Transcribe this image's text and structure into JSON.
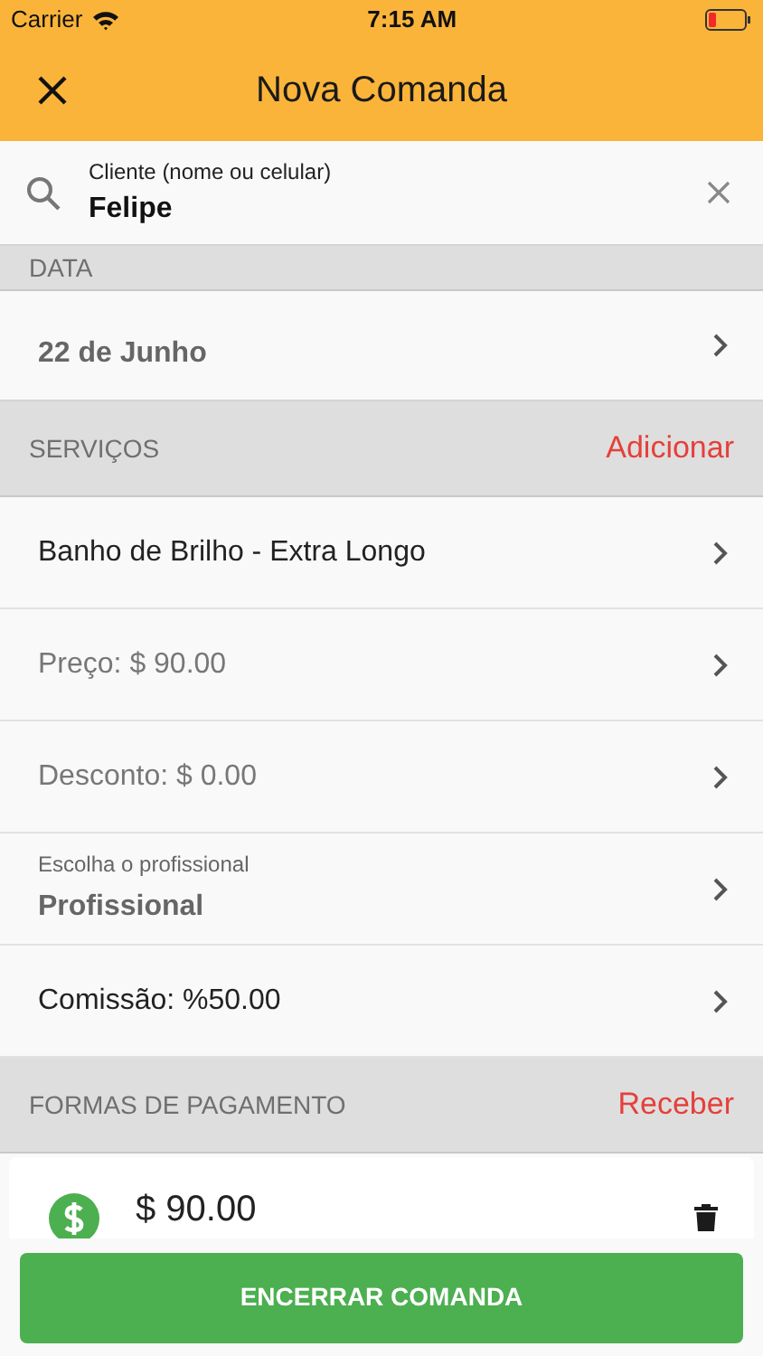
{
  "status_bar": {
    "carrier": "Carrier",
    "time": "7:15 AM"
  },
  "header": {
    "title": "Nova Comanda"
  },
  "client_field": {
    "label": "Cliente (nome ou celular)",
    "value": "Felipe"
  },
  "date_section": {
    "heading": "DATA",
    "value": "22 de Junho"
  },
  "services": {
    "heading": "SERVIÇOS",
    "action": "Adicionar",
    "rows": [
      {
        "kind": "title",
        "text": "Banho de Brilho - Extra Longo"
      },
      {
        "kind": "muted",
        "text": "Preço: $ 90.00"
      },
      {
        "kind": "muted",
        "text": "Desconto: $ 0.00"
      },
      {
        "kind": "caption",
        "caption": "Escolha o profissional",
        "text": "Profissional"
      },
      {
        "kind": "title",
        "text": "Comissão: %50.00"
      }
    ]
  },
  "payments": {
    "heading": "FORMAS DE PAGAMENTO",
    "action": "Receber",
    "items": [
      {
        "amount": "$ 90.00"
      }
    ]
  },
  "footer_button": "ENCERRAR COMANDA"
}
